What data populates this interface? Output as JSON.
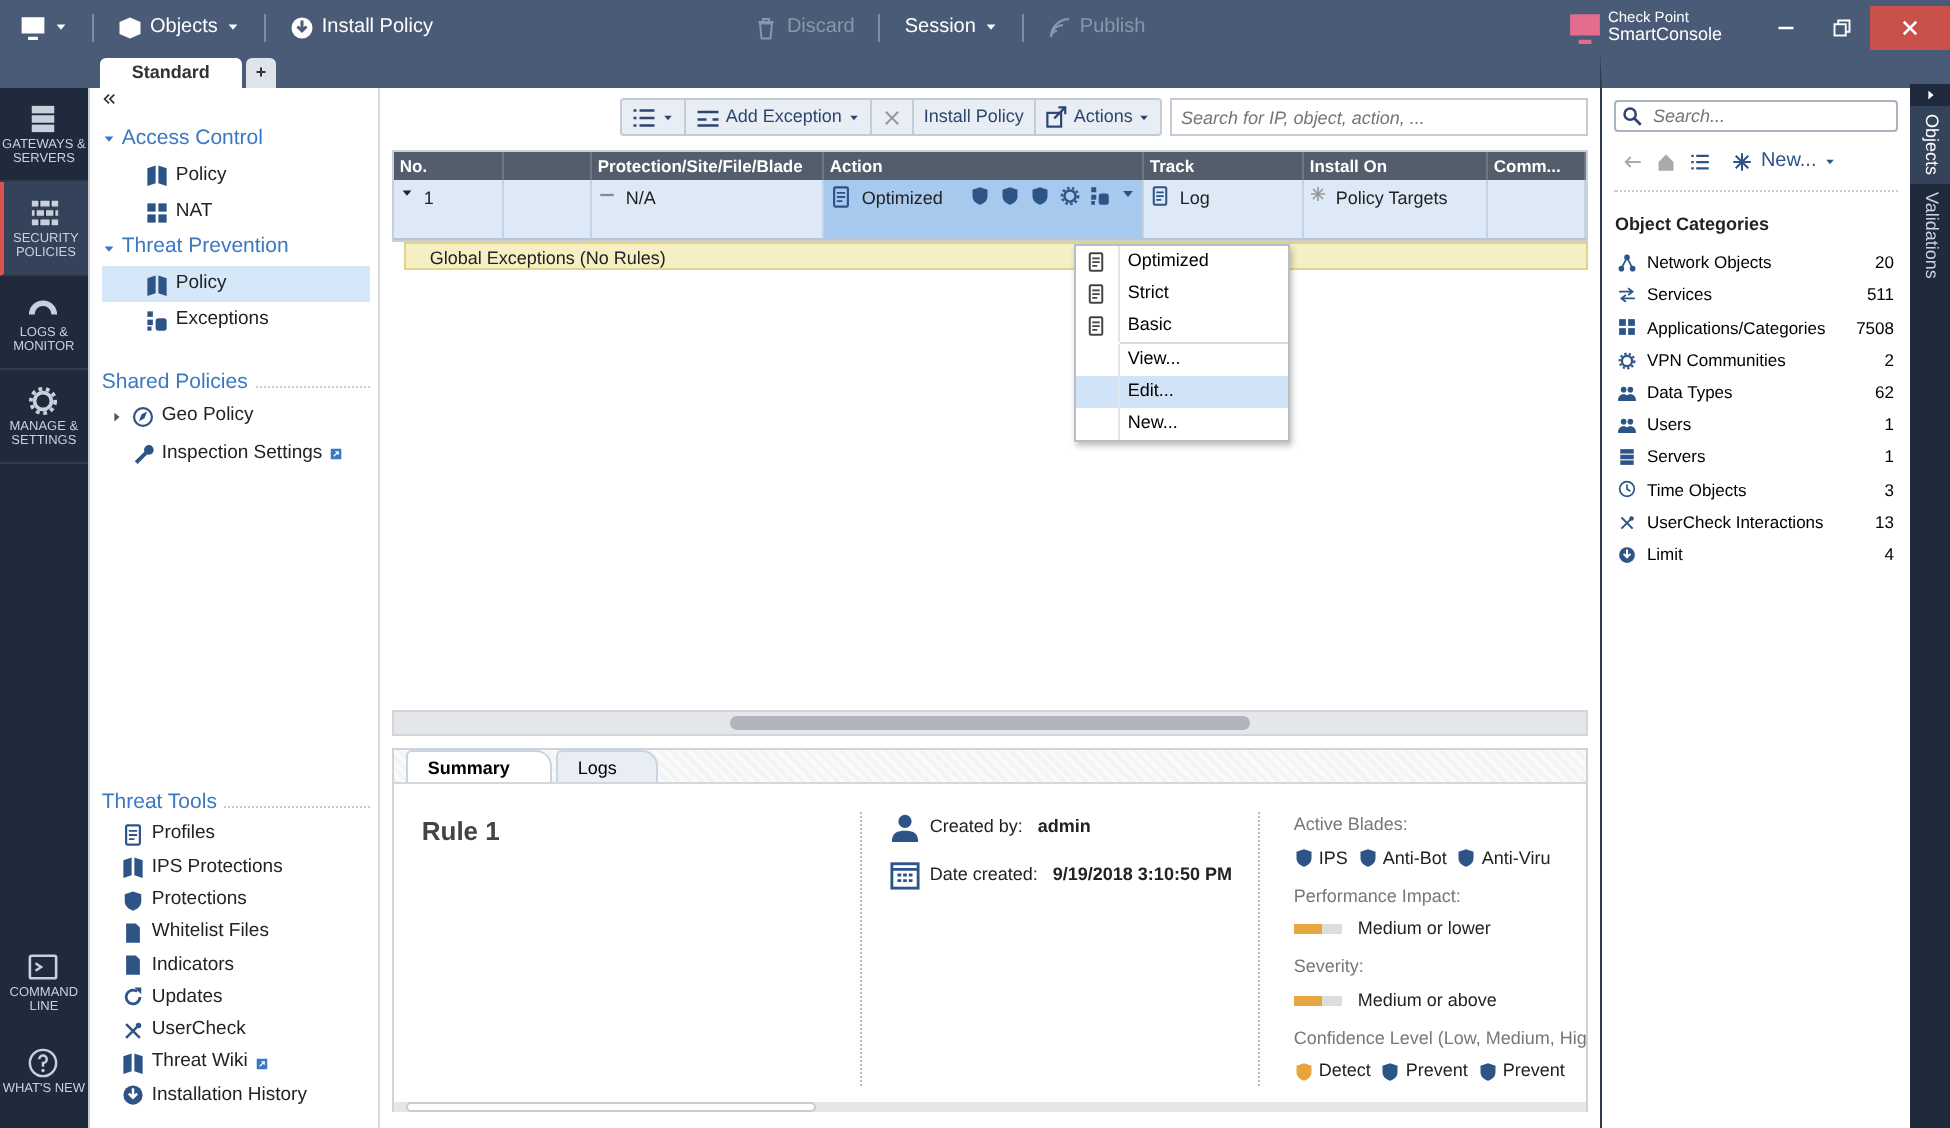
{
  "toolbar": {
    "objects": "Objects",
    "install": "Install Policy",
    "discard": {
      "label": "Discard",
      "disabled": true
    },
    "session": "Session",
    "publish": {
      "label": "Publish",
      "disabled": true
    }
  },
  "brand": {
    "line1": "Check Point",
    "line2": "SmartConsole"
  },
  "rail": [
    {
      "label": "GATEWAYS & SERVERS",
      "selected": false
    },
    {
      "label": "SECURITY POLICIES",
      "selected": true
    },
    {
      "label": "LOGS & MONITOR",
      "selected": false
    },
    {
      "label": "MANAGE & SETTINGS",
      "selected": false
    }
  ],
  "rail_bottom": [
    {
      "label": "COMMAND LINE"
    },
    {
      "label": "WHAT'S NEW"
    }
  ],
  "policy_tabs": [
    {
      "label": "Standard",
      "selected": true
    },
    {
      "label": "+",
      "selected": false
    }
  ],
  "tree": [
    {
      "kind": "group",
      "label": "Access Control",
      "expanded": true,
      "children": [
        {
          "label": "Policy",
          "selected": false
        },
        {
          "label": "NAT",
          "selected": false
        }
      ]
    },
    {
      "kind": "group",
      "label": "Threat Prevention",
      "expanded": true,
      "children": [
        {
          "label": "Policy",
          "selected": true
        },
        {
          "label": "Exceptions",
          "selected": false
        }
      ]
    }
  ],
  "shared": {
    "title": "Shared Policies",
    "items": [
      {
        "label": "Geo Policy",
        "expandable": true,
        "external": false
      },
      {
        "label": "Inspection Settings",
        "expandable": false,
        "external": true
      }
    ]
  },
  "tools": {
    "title": "Threat Tools",
    "items": [
      {
        "label": "Profiles",
        "external": false
      },
      {
        "label": "IPS Protections",
        "external": false
      },
      {
        "label": "Protections",
        "external": false
      },
      {
        "label": "Whitelist Files",
        "external": false
      },
      {
        "label": "Indicators",
        "external": false
      },
      {
        "label": "Updates",
        "external": false
      },
      {
        "label": "UserCheck",
        "external": false
      },
      {
        "label": "Threat Wiki",
        "external": true
      },
      {
        "label": "Installation History",
        "external": false
      }
    ]
  },
  "rules_toolbar": {
    "add": "Add Exception",
    "install": "Install Policy",
    "actions": "Actions",
    "search_placeholder": "Search for IP, object, action, ..."
  },
  "table": {
    "columns": [
      "No.",
      "",
      "Protection/Site/File/Blade",
      "Action",
      "Track",
      "Install On",
      "Comm..."
    ],
    "rows": [
      {
        "expanded": true,
        "no": "1",
        "protection": "N/A",
        "action": "Optimized",
        "track": "Log",
        "install_on": "Policy Targets"
      }
    ],
    "global": "Global Exceptions (No Rules)"
  },
  "context_menu": [
    {
      "label": "Optimized",
      "kind": "profile",
      "hovered": false
    },
    {
      "label": "Strict",
      "kind": "profile",
      "hovered": false
    },
    {
      "label": "Basic",
      "kind": "profile",
      "hovered": false
    },
    {
      "label": "View...",
      "kind": "plain",
      "hovered": false
    },
    {
      "label": "Edit...",
      "kind": "plain",
      "hovered": true
    },
    {
      "label": "New...",
      "kind": "plain",
      "hovered": false
    }
  ],
  "details": {
    "tabs": [
      {
        "label": "Summary",
        "selected": true
      },
      {
        "label": "Logs",
        "selected": false
      }
    ],
    "title": "Rule 1",
    "created_by_label": "Created by:",
    "created_by": "admin",
    "date_label": "Date created:",
    "date": "9/19/2018 3:10:50 PM",
    "blades_label": "Active Blades:",
    "blades": [
      "IPS",
      "Anti-Bot",
      "Anti-Viru"
    ],
    "perf_label": "Performance Impact:",
    "perf": {
      "level": 0.6,
      "text": "Medium or lower"
    },
    "sev_label": "Severity:",
    "sev": {
      "level": 0.6,
      "text": "Medium or above"
    },
    "conf_label": "Confidence Level (Low, Medium, Hig",
    "confidence": [
      {
        "label": "Detect",
        "color": "#e8a33a"
      },
      {
        "label": "Prevent",
        "color": "#2d5487"
      },
      {
        "label": "Prevent",
        "color": "#2d5487"
      }
    ]
  },
  "objects": {
    "search_placeholder": "Search...",
    "new": "New...",
    "heading": "Object Categories",
    "categories": [
      {
        "label": "Network Objects",
        "count": "20"
      },
      {
        "label": "Services",
        "count": "511"
      },
      {
        "label": "Applications/Categories",
        "count": "7508"
      },
      {
        "label": "VPN Communities",
        "count": "2"
      },
      {
        "label": "Data Types",
        "count": "62"
      },
      {
        "label": "Users",
        "count": "1"
      },
      {
        "label": "Servers",
        "count": "1"
      },
      {
        "label": "Time Objects",
        "count": "3"
      },
      {
        "label": "UserCheck Interactions",
        "count": "13"
      },
      {
        "label": "Limit",
        "count": "4"
      }
    ]
  },
  "side_tabs": [
    {
      "label": "Objects",
      "selected": true
    },
    {
      "label": "Validations",
      "selected": false
    }
  ]
}
